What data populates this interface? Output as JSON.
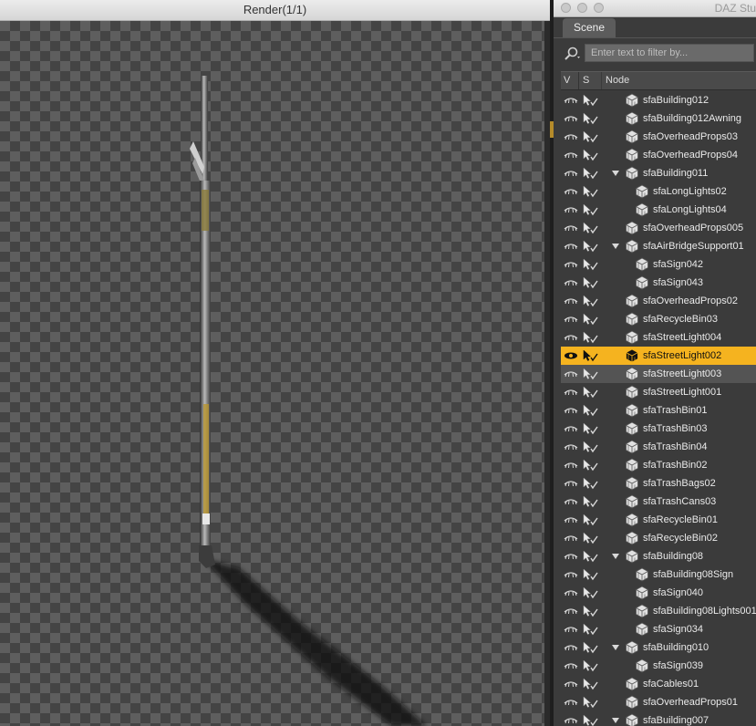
{
  "render_window": {
    "title": "Render(1/1)"
  },
  "daz_window": {
    "title": "DAZ Stu",
    "tab": "Scene",
    "filter_placeholder": "Enter text to filter by...",
    "columns": {
      "v": "V",
      "s": "S",
      "node": "Node"
    },
    "colors": {
      "selected": "#f5b31f",
      "accent": "#b58b2a"
    },
    "nodes": [
      {
        "label": "sfaBuilding012",
        "depth": 0,
        "expander": false
      },
      {
        "label": "sfaBuilding012Awning",
        "depth": 0,
        "expander": false
      },
      {
        "label": "sfaOverheadProps03",
        "depth": 0,
        "expander": false
      },
      {
        "label": "sfaOverheadProps04",
        "depth": 0,
        "expander": false
      },
      {
        "label": "sfaBuilding011",
        "depth": 0,
        "expander": true
      },
      {
        "label": "sfaLongLights02",
        "depth": 1,
        "expander": false
      },
      {
        "label": "sfaLongLights04",
        "depth": 1,
        "expander": false
      },
      {
        "label": "sfaOverheadProps005",
        "depth": 0,
        "expander": false
      },
      {
        "label": "sfaAirBridgeSupport01",
        "depth": 0,
        "expander": true
      },
      {
        "label": "sfaSign042",
        "depth": 1,
        "expander": false
      },
      {
        "label": "sfaSign043",
        "depth": 1,
        "expander": false
      },
      {
        "label": "sfaOverheadProps02",
        "depth": 0,
        "expander": false
      },
      {
        "label": "sfaRecycleBin03",
        "depth": 0,
        "expander": false
      },
      {
        "label": "sfaStreetLight004",
        "depth": 0,
        "expander": false
      },
      {
        "label": "sfaStreetLight002",
        "depth": 0,
        "expander": false,
        "selected": true
      },
      {
        "label": "sfaStreetLight003",
        "depth": 0,
        "expander": false,
        "hover": true
      },
      {
        "label": "sfaStreetLight001",
        "depth": 0,
        "expander": false
      },
      {
        "label": "sfaTrashBin01",
        "depth": 0,
        "expander": false
      },
      {
        "label": "sfaTrashBin03",
        "depth": 0,
        "expander": false
      },
      {
        "label": "sfaTrashBin04",
        "depth": 0,
        "expander": false
      },
      {
        "label": "sfaTrashBin02",
        "depth": 0,
        "expander": false
      },
      {
        "label": "sfaTrashBags02",
        "depth": 0,
        "expander": false
      },
      {
        "label": "sfaTrashCans03",
        "depth": 0,
        "expander": false
      },
      {
        "label": "sfaRecycleBin01",
        "depth": 0,
        "expander": false
      },
      {
        "label": "sfaRecycleBin02",
        "depth": 0,
        "expander": false
      },
      {
        "label": "sfaBuilding08",
        "depth": 0,
        "expander": true
      },
      {
        "label": "sfaBuilding08Sign",
        "depth": 1,
        "expander": false
      },
      {
        "label": "sfaSign040",
        "depth": 1,
        "expander": false
      },
      {
        "label": "sfaBuilding08Lights001",
        "depth": 1,
        "expander": false
      },
      {
        "label": "sfaSign034",
        "depth": 1,
        "expander": false
      },
      {
        "label": "sfaBuilding010",
        "depth": 0,
        "expander": true
      },
      {
        "label": "sfaSign039",
        "depth": 1,
        "expander": false
      },
      {
        "label": "sfaCables01",
        "depth": 0,
        "expander": false
      },
      {
        "label": "sfaOverheadProps01",
        "depth": 0,
        "expander": false
      },
      {
        "label": "sfaBuilding007",
        "depth": 0,
        "expander": true
      }
    ]
  }
}
